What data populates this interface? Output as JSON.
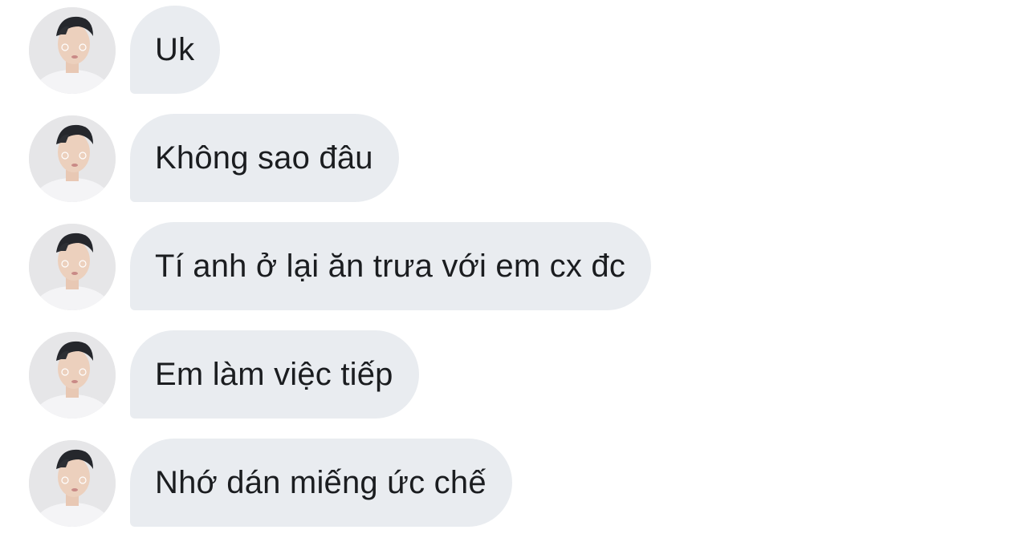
{
  "messages": [
    {
      "text": "Uk"
    },
    {
      "text": "Không sao đâu"
    },
    {
      "text": "Tí anh ở lại ăn trưa với em cx đc"
    },
    {
      "text": "Em làm việc tiếp"
    },
    {
      "text": "Nhớ dán miếng ức chế"
    }
  ],
  "colors": {
    "bubble": "#e9ecf0",
    "text": "#1b1d20",
    "background": "#ffffff"
  }
}
